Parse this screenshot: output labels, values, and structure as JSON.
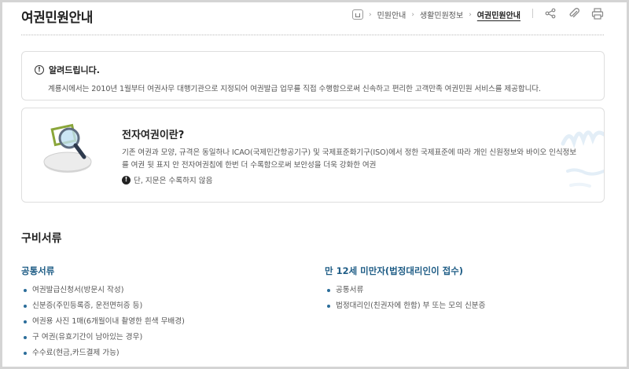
{
  "header": {
    "title": "여권민원안내",
    "breadcrumb": [
      "민원안내",
      "생활민원정보"
    ],
    "breadcrumb_current": "여권민원안내",
    "icons": [
      "home-icon",
      "share-icon",
      "link-icon",
      "print-icon"
    ]
  },
  "notice": {
    "title": "알려드립니다.",
    "text": "계룡시에서는 2010년 1월부터 여권사무 대행기관으로 지정되어 여권발급 업무를 직접 수행함으로써 신속하고 편리한 고객만족 여권민원 서비스를 제공합니다."
  },
  "epassport": {
    "title": "전자여권이란?",
    "description": "기존 여권과 모양, 규격은 동일하나 ICAO(국제민간항공기구) 및 국제표준화기구(ISO)에서 정한 국제표준에 따라 개인 신원정보와 바이오 인식정보를 여권 뒷 표지 안 전자여권칩에 한번 더 수록함으로써 보안성을 더욱 강화한 여권",
    "note": "단, 지문은 수록하지 않음"
  },
  "documents": {
    "title": "구비서류",
    "common": {
      "title": "공통서류",
      "items": [
        "여권발급신청서(방문시 작성)",
        "신분증(주민등록증, 운전면허증 등)",
        "여권용 사진 1매(6개월이내 촬영한 흰색 무배경)",
        "구 여권(유효기간이 남아있는 경우)",
        "수수료(현금,카드결제 가능)"
      ]
    },
    "minor": {
      "title": "만 12세 미만자(법정대리인이 접수)",
      "items": [
        "공통서류",
        "법정대리인(친권자에 한함) 부 또는 모의 신분증"
      ]
    }
  },
  "colors": {
    "accent": "#1f5d86",
    "bullet": "#2b6d9a",
    "border": "#dedede"
  }
}
